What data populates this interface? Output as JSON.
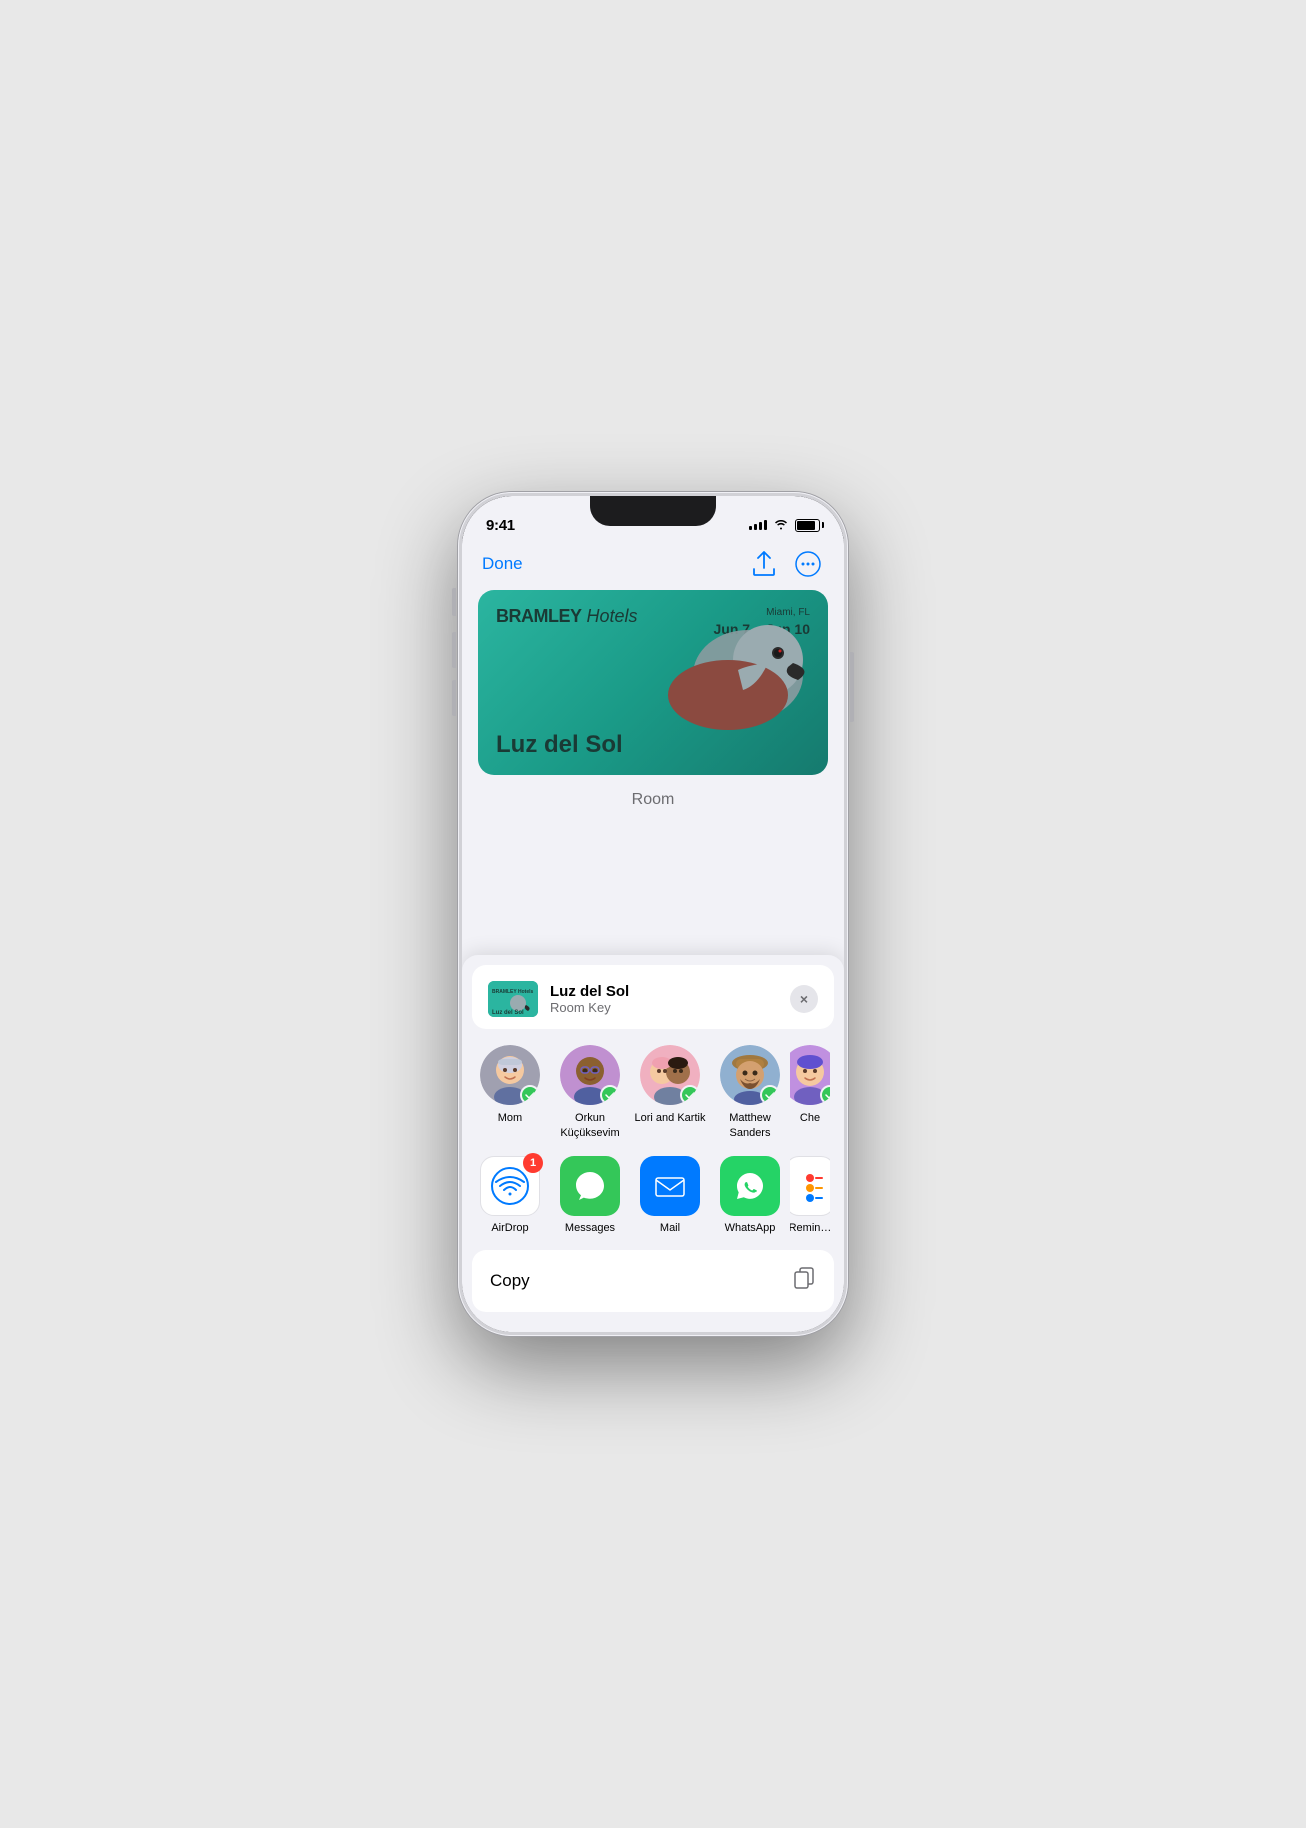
{
  "phone": {
    "status": {
      "time": "9:41",
      "signal_bars": [
        4,
        6,
        8,
        10,
        12
      ],
      "battery_level": 85
    }
  },
  "nav": {
    "done_label": "Done"
  },
  "hotel_card": {
    "brand": "BRAMLEY",
    "brand_italic": " Hotels",
    "location": "Miami, FL",
    "date_range": "Jun 7 – Jun 10",
    "guest_name": "Luz del Sol"
  },
  "room_label": "Room",
  "share_sheet": {
    "title": "Luz del Sol",
    "subtitle": "Room Key",
    "close_label": "×",
    "contacts": [
      {
        "name": "Mom",
        "avatar_type": "mom"
      },
      {
        "name": "Orkun Küçüksevim",
        "avatar_type": "orkun"
      },
      {
        "name": "Lori and Kartik",
        "avatar_type": "lori"
      },
      {
        "name": "Matthew Sanders",
        "avatar_type": "matthew"
      },
      {
        "name": "Che Boe",
        "avatar_type": "che"
      }
    ],
    "apps": [
      {
        "name": "AirDrop",
        "type": "airdrop",
        "badge": "1"
      },
      {
        "name": "Messages",
        "type": "messages",
        "badge": ""
      },
      {
        "name": "Mail",
        "type": "mail",
        "badge": ""
      },
      {
        "name": "WhatsApp",
        "type": "whatsapp",
        "badge": ""
      },
      {
        "name": "Reminders",
        "type": "reminders",
        "badge": ""
      }
    ],
    "copy_label": "Copy"
  }
}
